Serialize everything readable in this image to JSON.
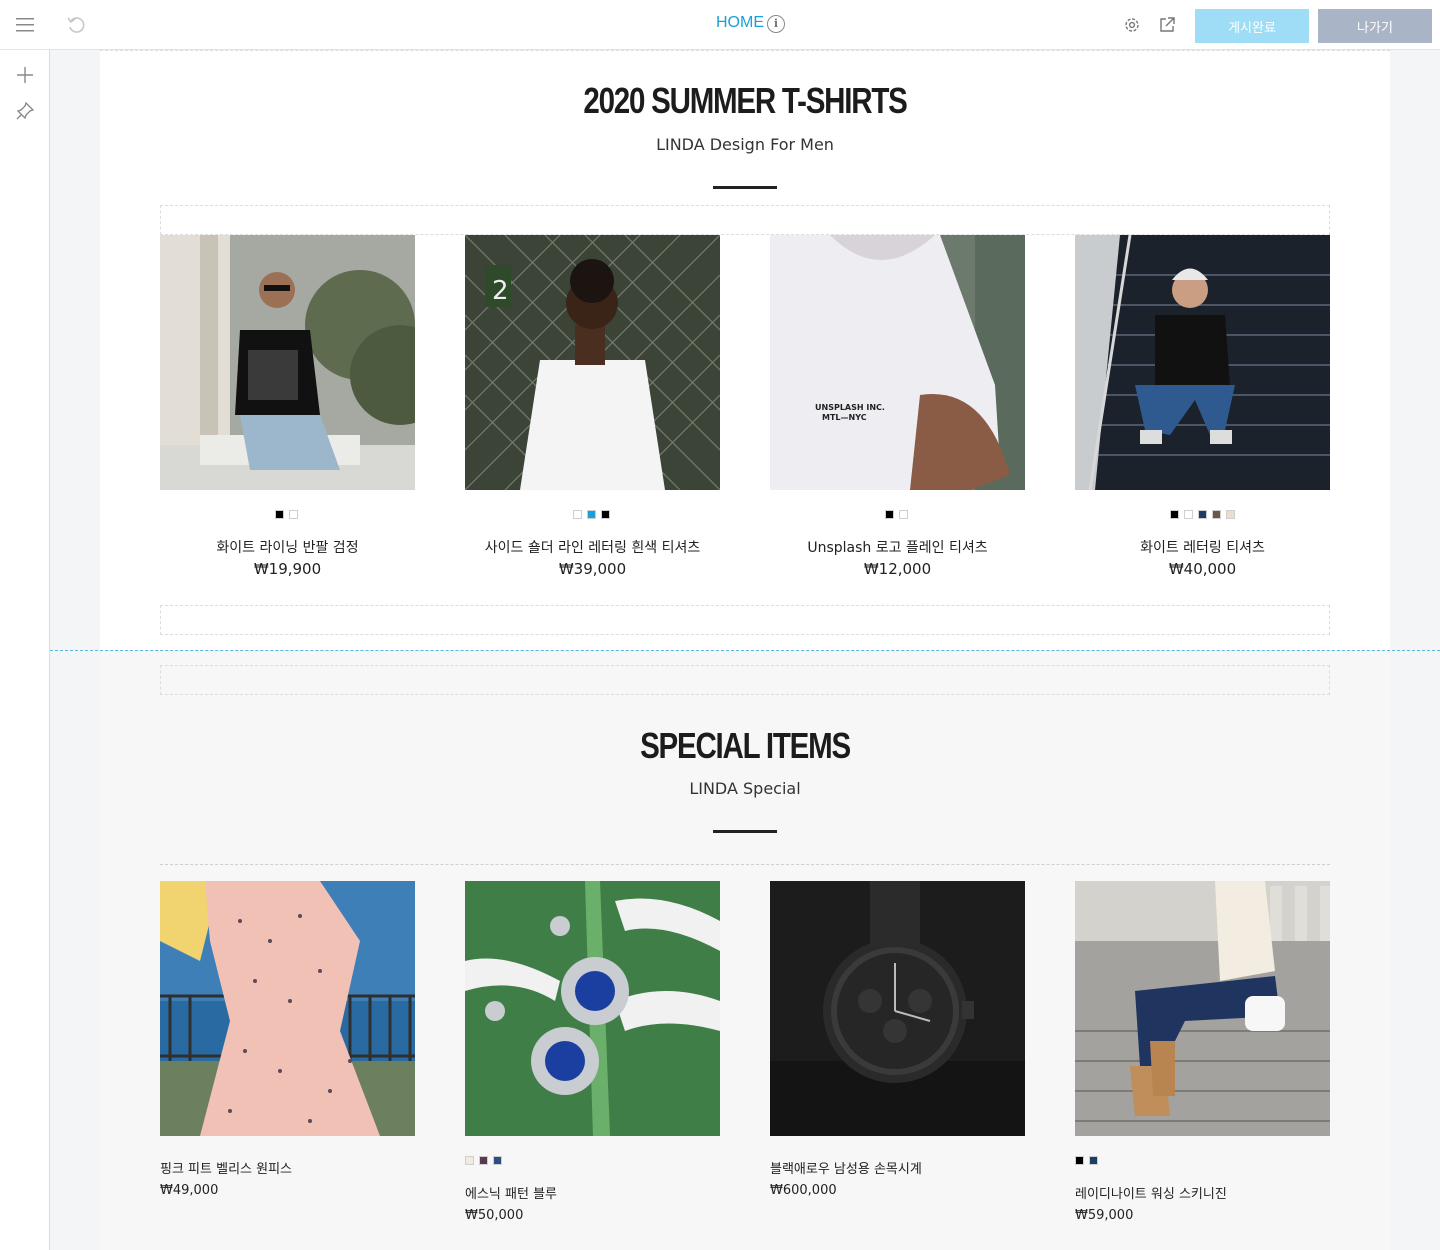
{
  "topbar": {
    "page_name": "HOME",
    "info_glyph": "i",
    "publish_label": "게시완료",
    "exit_label": "나가기",
    "icons": [
      "menu-icon",
      "undo-icon",
      "info-icon",
      "settings-icon",
      "external-link-icon"
    ]
  },
  "leftbar": {
    "icons": [
      "add-icon",
      "design-pin-icon"
    ]
  },
  "section1": {
    "title": "2020 SUMMER T-SHIRTS",
    "subtitle": "LINDA Design For Men",
    "products": [
      {
        "name": "화이트 라이닝 반팔 검정",
        "price": "₩19,900",
        "swatches": [
          "#000000",
          "#ffffff"
        ]
      },
      {
        "name": "사이드 숄더 라인 레터링 흰색 티셔츠",
        "price": "₩39,000",
        "swatches": [
          "#ffffff",
          "#1a9fd6",
          "#000000"
        ]
      },
      {
        "name": "Unsplash 로고 플레인 티셔츠",
        "price": "₩12,000",
        "swatches": [
          "#000000",
          "#ffffff"
        ]
      },
      {
        "name": "화이트 레터링 티셔츠",
        "price": "₩40,000",
        "swatches": [
          "#000000",
          "#ffffff",
          "#1d3d63",
          "#6b5846",
          "#eadfcf"
        ]
      }
    ]
  },
  "section2": {
    "title": "SPECIAL ITEMS",
    "subtitle": "LINDA Special",
    "products": [
      {
        "name": "핑크 피트 벨리스 원피스",
        "price": "₩49,000",
        "swatches": []
      },
      {
        "name": "에스닉 패턴 블루",
        "price": "₩50,000",
        "swatches": [
          "#f1ebdd",
          "#5a3a4f",
          "#2f4e82"
        ]
      },
      {
        "name": "블랙애로우 남성용 손목시계",
        "price": "₩600,000",
        "swatches": []
      },
      {
        "name": "레이디나이트 워싱 스키니진",
        "price": "₩59,000",
        "swatches": [
          "#000000",
          "#1d3d63"
        ]
      }
    ]
  },
  "colors": {
    "accent": "#1ba0d7",
    "publish_bg": "#9fdcf5",
    "exit_bg": "#a9b5c6"
  }
}
